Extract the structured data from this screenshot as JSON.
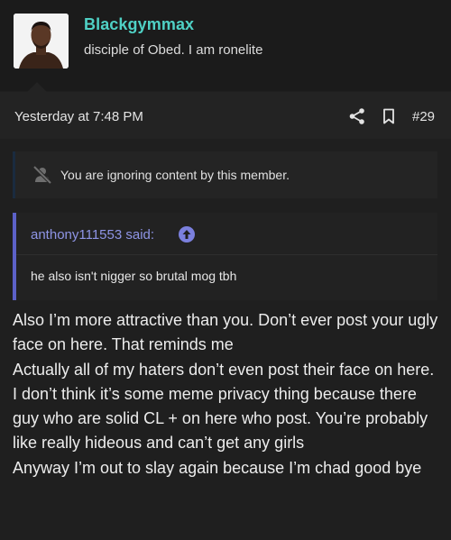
{
  "user": {
    "name": "Blackgymmax",
    "title": "disciple of Obed. I am ronelite"
  },
  "post": {
    "date": "Yesterday at 7:48 PM",
    "number": "#29"
  },
  "ignored_notice": "You are ignoring content by this member.",
  "quote": {
    "author": "anthony111553 said:",
    "text": "he also isn't nigger so brutal mog tbh"
  },
  "message": {
    "lines": [
      "Also I’m more attractive than you. Don’t ever post your ugly face on here. That reminds me",
      "Actually all of my haters don’t even post their face on here. I don’t think it’s some meme privacy thing because there guy who are solid CL + on here who post. You’re probably like really hideous and can’t get any girls",
      "Anyway I’m out to slay again because I’m chad good bye"
    ]
  },
  "colors": {
    "username": "#4fd1c5",
    "quote_accent": "#5c61c8",
    "background": "#1f1f1f"
  },
  "icons": {
    "share": "share-icon",
    "bookmark": "bookmark-icon",
    "ignored": "user-slash-icon",
    "quote_jump": "arrow-up-circle-icon"
  }
}
